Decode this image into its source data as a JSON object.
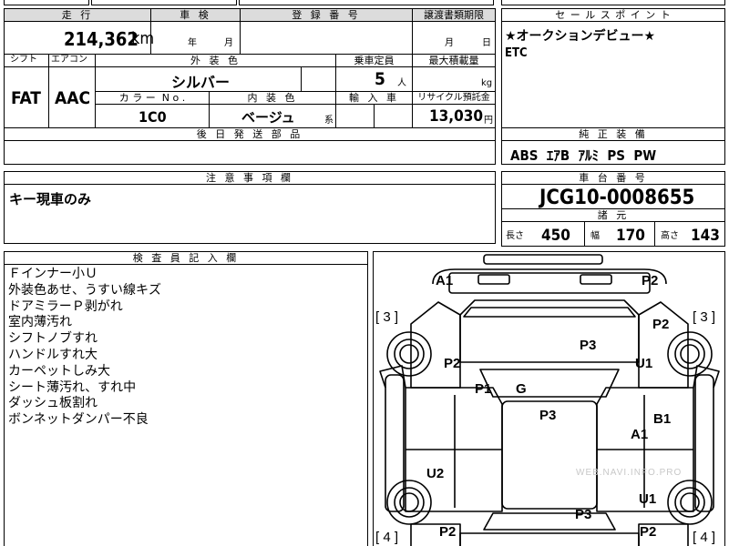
{
  "top": {
    "mileage_label": "走 行",
    "mileage_value": "214,362",
    "mileage_unit": "km",
    "inspection_label": "車 検",
    "inspection_year": "年",
    "inspection_month": "月",
    "registration_label": "登 録 番 号",
    "transfer_label": "譲渡書類期限",
    "transfer_month": "月",
    "transfer_day": "日"
  },
  "specs": {
    "shift_label": "シフト",
    "shift_value": "FAT",
    "ac_label": "エアコン",
    "ac_value": "AAC",
    "exterior_color_label": "外 装 色",
    "exterior_color_value": "シルバー",
    "capacity_label": "乗車定員",
    "capacity_value": "5",
    "capacity_unit": "人",
    "max_load_label": "最大積載量",
    "max_load_unit": "kg",
    "color_no_label": "カ ラ ー  N o .",
    "color_no_value": "1C0",
    "interior_color_label": "内 装 色",
    "interior_color_value": "ベージュ",
    "interior_color_suffix": "系",
    "import_label": "輸 入 車",
    "recycle_label": "リサイクル預託金",
    "recycle_value": "13,030",
    "recycle_unit": "円",
    "later_parts_label": "後 日 発 送 部 品"
  },
  "sales_point": {
    "label": "セ ー ル ス ポ イ ン ト",
    "lines": [
      "★オークションデビュー★",
      "ETC"
    ]
  },
  "standard_equipment": {
    "label": "純 正 装 備",
    "value": "ABS  ｴｱB  ｱﾙﾐ  PS  PW"
  },
  "notes": {
    "label": "注 意 事 項 欄",
    "value": "キー現車のみ"
  },
  "chassis": {
    "label": "車 台 番 号",
    "value": "JCG10-0008655"
  },
  "dimensions": {
    "label": "諸 元",
    "length_label": "長さ",
    "length_value": "450",
    "width_label": "幅",
    "width_value": "170",
    "height_label": "高さ",
    "height_value": "143"
  },
  "inspector": {
    "label": "検 査 員 記 入 欄",
    "lines": [
      "Ｆインナー小Ｕ",
      "外装色あせ、うすい線キズ",
      "ドアミラーＰ剥がれ",
      "室内薄汚れ",
      "シフトノブすれ",
      "ハンドルすれ大",
      "カーペットしみ大",
      "シート薄汚れ、すれ中",
      "ダッシュ板割れ",
      "ボンネットダンパー不良"
    ]
  },
  "diagram": {
    "marks": {
      "front_left": "A1",
      "front_right": "P2",
      "hood_fender_left": "P2",
      "hood_fender_right": "P2",
      "hood": "P3",
      "pillar_left": "P1",
      "windshield": "G",
      "roof": "P3",
      "fender_right": "U1",
      "door_right_1": "B1",
      "door_right_2": "A1",
      "rear_left": "U2",
      "rear_right": "U1",
      "trunk": "P3",
      "rear_corner_left": "P2",
      "rear_corner_right": "P2"
    },
    "tires": {
      "front_left": "3",
      "front_right": "3",
      "rear_left": "4",
      "rear_right": "4"
    },
    "watermark": "WEB.NAVI.INFO.PRO"
  }
}
